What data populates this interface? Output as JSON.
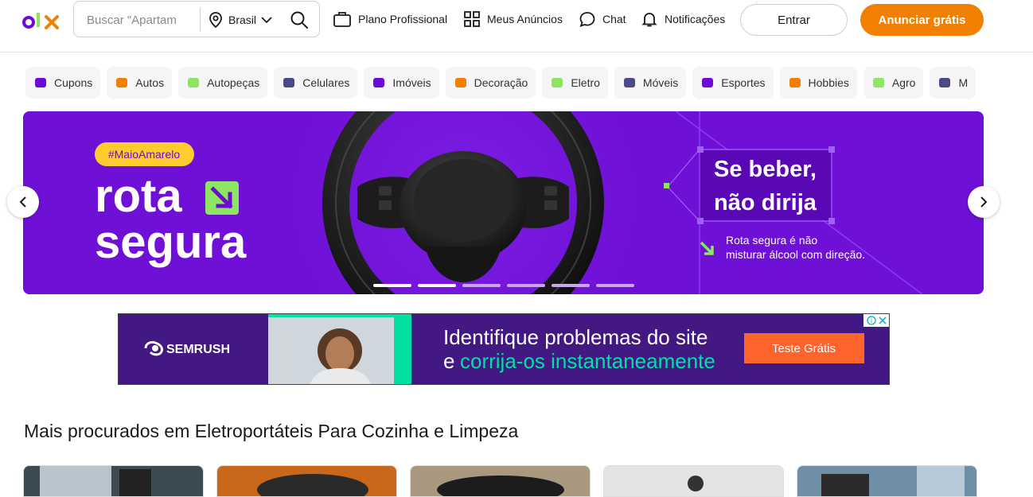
{
  "header": {
    "logo_text": "OLX",
    "search_placeholder": "Buscar \"Apartam",
    "location": "Brasil",
    "nav": {
      "plano": "Plano Profissional",
      "meus_anuncios": "Meus Anúncios",
      "chat": "Chat",
      "notificacoes": "Notificações"
    },
    "entrar": "Entrar",
    "anunciar": "Anunciar grátis"
  },
  "categories": [
    {
      "label": "Cupons",
      "icon": "coupon-icon"
    },
    {
      "label": "Autos",
      "icon": "car-icon"
    },
    {
      "label": "Autopeças",
      "icon": "tire-icon"
    },
    {
      "label": "Celulares",
      "icon": "phone-icon"
    },
    {
      "label": "Imóveis",
      "icon": "house-icon"
    },
    {
      "label": "Decoração",
      "icon": "lamp-icon"
    },
    {
      "label": "Eletro",
      "icon": "washer-icon"
    },
    {
      "label": "Móveis",
      "icon": "sofa-icon"
    },
    {
      "label": "Esportes",
      "icon": "ball-icon"
    },
    {
      "label": "Hobbies",
      "icon": "guitar-icon"
    },
    {
      "label": "Agro",
      "icon": "tractor-icon"
    },
    {
      "label": "M",
      "icon": "bus-icon"
    }
  ],
  "banner": {
    "hashtag": "#MaioAmarelo",
    "title_line1": "rota",
    "title_line2": "segura",
    "headline_line1": "Se beber,",
    "headline_line2": "não dirija",
    "subtext_line1": "Rota segura é não",
    "subtext_line2": "misturar álcool com direção.",
    "slides_count": 6,
    "active_slide": 2
  },
  "ad": {
    "brand": "SEMRUSH",
    "headline_line1": "Identifique problemas do site",
    "headline_line2_prefix": "e",
    "headline_line2_highlight": "corrija-os instantaneamente",
    "cta": "Teste Grátis"
  },
  "section": {
    "title": "Mais procurados em Eletroportáteis Para Cozinha e Limpeza"
  },
  "colors": {
    "olx_purple": "#6e0ad6",
    "olx_orange": "#f28000",
    "olx_green": "#8ce563",
    "banner_bg": "#6f10d6",
    "hashtag_yellow": "#ffcb2f",
    "ad_bg": "#421983",
    "ad_cta": "#ff642d",
    "ad_green": "#00e0a3"
  }
}
